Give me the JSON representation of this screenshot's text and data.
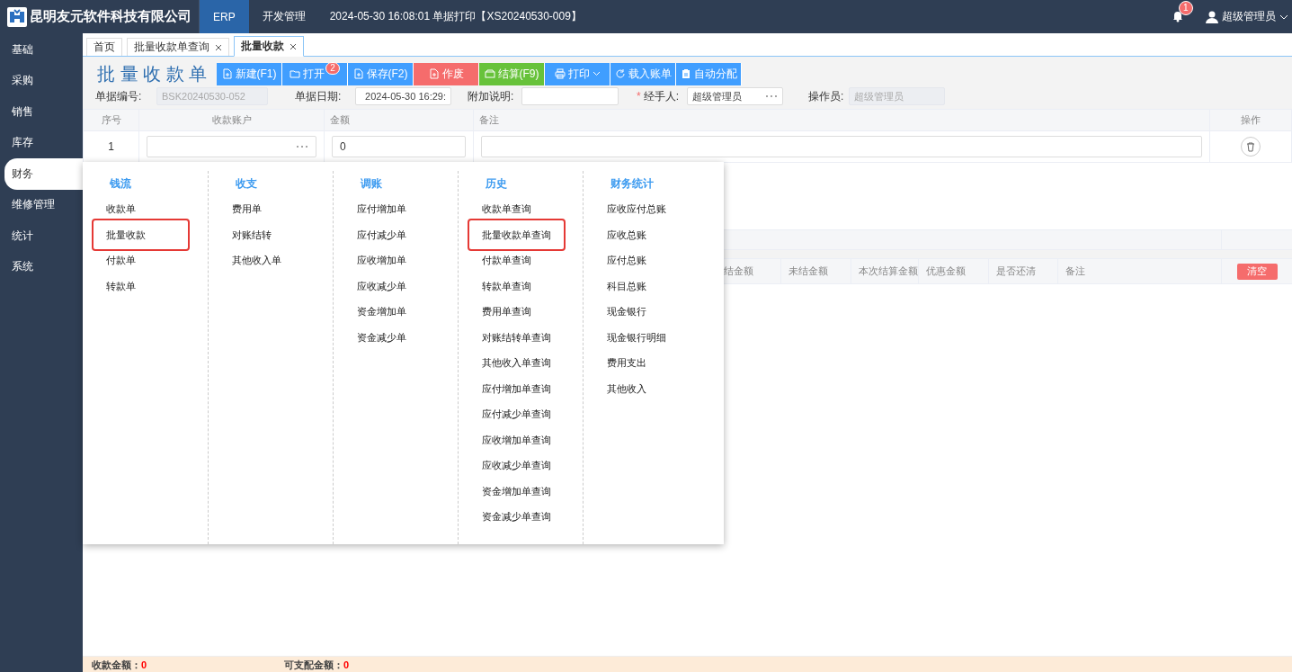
{
  "header": {
    "company": "昆明友元软件科技有限公司",
    "nav": [
      {
        "label": "ERP",
        "selected": true
      },
      {
        "label": "开发管理",
        "selected": false
      }
    ],
    "notice": "2024-05-30 16:08:01 单据打印【XS20240530-009】",
    "notification_count": "1",
    "user": "超级管理员"
  },
  "sidebar": {
    "items": [
      {
        "label": "基础",
        "selected": false
      },
      {
        "label": "采购",
        "selected": false
      },
      {
        "label": "销售",
        "selected": false
      },
      {
        "label": "库存",
        "selected": false
      },
      {
        "label": "财务",
        "selected": true
      },
      {
        "label": "维修管理",
        "selected": false
      },
      {
        "label": "统计",
        "selected": false
      },
      {
        "label": "系统",
        "selected": false
      }
    ]
  },
  "page_tabs": [
    {
      "label": "首页",
      "closable": false,
      "selected": false
    },
    {
      "label": "批量收款单查询",
      "closable": true,
      "selected": false
    },
    {
      "label": "批量收款",
      "closable": true,
      "selected": true
    }
  ],
  "form": {
    "title": "批 量 收 款 单",
    "toolbar": [
      {
        "label": "新建(F1)",
        "color": "#409eff"
      },
      {
        "label": "打开",
        "color": "#409eff",
        "badge": "2"
      },
      {
        "label": "保存(F2)",
        "color": "#409eff"
      },
      {
        "label": "作废",
        "color": "#f56c6c"
      },
      {
        "label": "结算(F9)",
        "color": "#67c23a"
      },
      {
        "label": "打印",
        "color": "#409eff",
        "dropdown": true
      },
      {
        "label": "载入账单",
        "color": "#409eff"
      },
      {
        "label": "自动分配",
        "color": "#409eff"
      }
    ],
    "fields": [
      {
        "label": "单据编号:",
        "kind": "text",
        "value": "BSK20240530-052",
        "disabled": true
      },
      {
        "label": "单据日期:",
        "kind": "date",
        "value": "2024-05-30 16:29:",
        "disabled": false
      },
      {
        "label": "附加说明:",
        "kind": "text",
        "disabled": false
      },
      {
        "label": "经手人:",
        "kind": "picker",
        "value": "超级管理员",
        "disabled": false,
        "required_mark": "*"
      },
      {
        "label": "操作员:",
        "kind": "text",
        "value": "超级管理员",
        "disabled": true
      }
    ]
  },
  "accounts_table": {
    "columns": [
      "序号",
      "收款账户",
      "金额",
      "备注",
      "操作"
    ],
    "rows": [
      {
        "index": "1",
        "amount": "0"
      }
    ]
  },
  "detail_table": {
    "columns": [
      "结金额",
      "未结金额",
      "本次结算金额",
      "优惠金额",
      "是否还清",
      "备注"
    ],
    "clear_button": "清空"
  },
  "footer": [
    {
      "label": "收款金额：",
      "value": "0"
    },
    {
      "label": "可支配金额：",
      "value": "0"
    }
  ],
  "menu": {
    "columns": [
      {
        "heading": "钱流",
        "items": [
          {
            "label": "收款单",
            "highlighted": false
          },
          {
            "label": "批量收款",
            "highlighted": true
          },
          {
            "label": "付款单",
            "highlighted": false
          },
          {
            "label": "转款单",
            "highlighted": false
          }
        ]
      },
      {
        "heading": "收支",
        "items": [
          {
            "label": "费用单",
            "highlighted": false
          },
          {
            "label": "对账结转",
            "highlighted": false
          },
          {
            "label": "其他收入单",
            "highlighted": false
          }
        ]
      },
      {
        "heading": "调账",
        "items": [
          {
            "label": "应付增加单",
            "highlighted": false
          },
          {
            "label": "应付减少单",
            "highlighted": false
          },
          {
            "label": "应收增加单",
            "highlighted": false
          },
          {
            "label": "应收减少单",
            "highlighted": false
          },
          {
            "label": "资金增加单",
            "highlighted": false
          },
          {
            "label": "资金减少单",
            "highlighted": false
          }
        ]
      },
      {
        "heading": "历史",
        "items": [
          {
            "label": "收款单查询",
            "highlighted": false
          },
          {
            "label": "批量收款单查询",
            "highlighted": true
          },
          {
            "label": "付款单查询",
            "highlighted": false
          },
          {
            "label": "转款单查询",
            "highlighted": false
          },
          {
            "label": "费用单查询",
            "highlighted": false
          },
          {
            "label": "对账结转单查询",
            "highlighted": false
          },
          {
            "label": "其他收入单查询",
            "highlighted": false
          },
          {
            "label": "应付增加单查询",
            "highlighted": false
          },
          {
            "label": "应付减少单查询",
            "highlighted": false
          },
          {
            "label": "应收增加单查询",
            "highlighted": false
          },
          {
            "label": "应收减少单查询",
            "highlighted": false
          },
          {
            "label": "资金增加单查询",
            "highlighted": false
          },
          {
            "label": "资金减少单查询",
            "highlighted": false
          }
        ]
      },
      {
        "heading": "财务统计",
        "items": [
          {
            "label": "应收应付总账",
            "highlighted": false
          },
          {
            "label": "应收总账",
            "highlighted": false
          },
          {
            "label": "应付总账",
            "highlighted": false
          },
          {
            "label": "科目总账",
            "highlighted": false
          },
          {
            "label": "现金银行",
            "highlighted": false
          },
          {
            "label": "现金银行明细",
            "highlighted": false
          },
          {
            "label": "费用支出",
            "highlighted": false
          },
          {
            "label": "其他收入",
            "highlighted": false
          }
        ]
      }
    ]
  }
}
